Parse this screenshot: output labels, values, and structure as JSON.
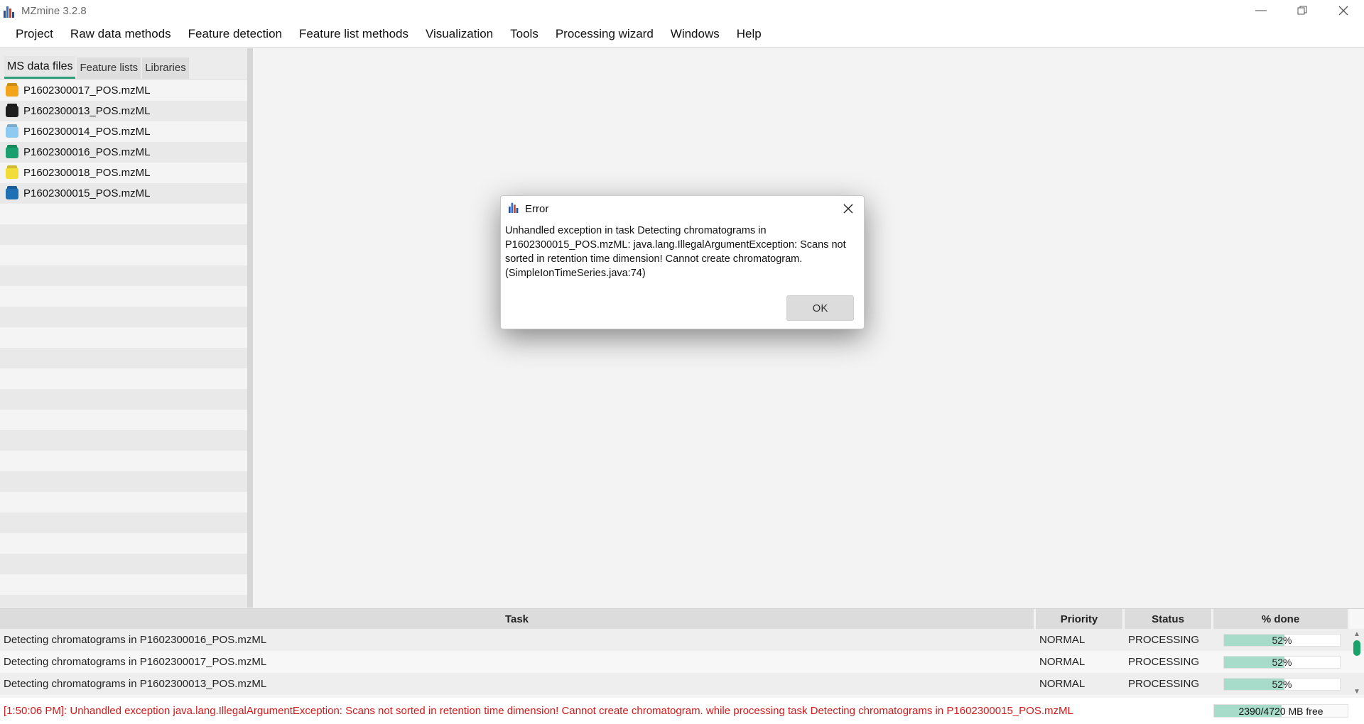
{
  "window": {
    "title": "MZmine 3.2.8",
    "controls": [
      "minimize-icon",
      "restore-icon",
      "close-icon"
    ]
  },
  "menu": [
    "Project",
    "Raw data methods",
    "Feature detection",
    "Feature list methods",
    "Visualization",
    "Tools",
    "Processing wizard",
    "Windows",
    "Help"
  ],
  "left_panel": {
    "tabs": [
      "MS data files",
      "Feature lists",
      "Libraries"
    ],
    "active_tab": "MS data files",
    "files": [
      {
        "name": "P1602300017_POS.mzML",
        "color": "#f2a51a"
      },
      {
        "name": "P1602300013_POS.mzML",
        "color": "#1d1d1d"
      },
      {
        "name": "P1602300014_POS.mzML",
        "color": "#8ec9ef"
      },
      {
        "name": "P1602300016_POS.mzML",
        "color": "#1aa06e"
      },
      {
        "name": "P1602300018_POS.mzML",
        "color": "#f2dc3a"
      },
      {
        "name": "P1602300015_POS.mzML",
        "color": "#1f6fb4"
      }
    ]
  },
  "dialog": {
    "title": "Error",
    "message": "Unhandled exception in task Detecting chromatograms in\nP1602300015_POS.mzML: java.lang.IllegalArgumentException: Scans not\nsorted in retention time dimension! Cannot create chromatogram.\n(SimpleIonTimeSeries.java:74)",
    "ok_label": "OK"
  },
  "tasks": {
    "headers": [
      "Task",
      "Priority",
      "Status",
      "% done"
    ],
    "rows": [
      {
        "task": "Detecting chromatograms in P1602300016_POS.mzML",
        "priority": "NORMAL",
        "status": "PROCESSING",
        "done": "52%",
        "progress": 0.52
      },
      {
        "task": "Detecting chromatograms in P1602300017_POS.mzML",
        "priority": "NORMAL",
        "status": "PROCESSING",
        "done": "52%",
        "progress": 0.52
      },
      {
        "task": "Detecting chromatograms in P1602300013_POS.mzML",
        "priority": "NORMAL",
        "status": "PROCESSING",
        "done": "52%",
        "progress": 0.52
      }
    ]
  },
  "status_bar": {
    "message": "[1:50:06 PM]: Unhandled exception java.lang.IllegalArgumentException: Scans not sorted in retention time dimension! Cannot create chromatogram. while processing task Detecting chromatograms in P1602300015_POS.mzML",
    "memory": "2390/4720 MB free",
    "memory_fraction": 0.5064,
    "message_color": "#d11a1a"
  }
}
